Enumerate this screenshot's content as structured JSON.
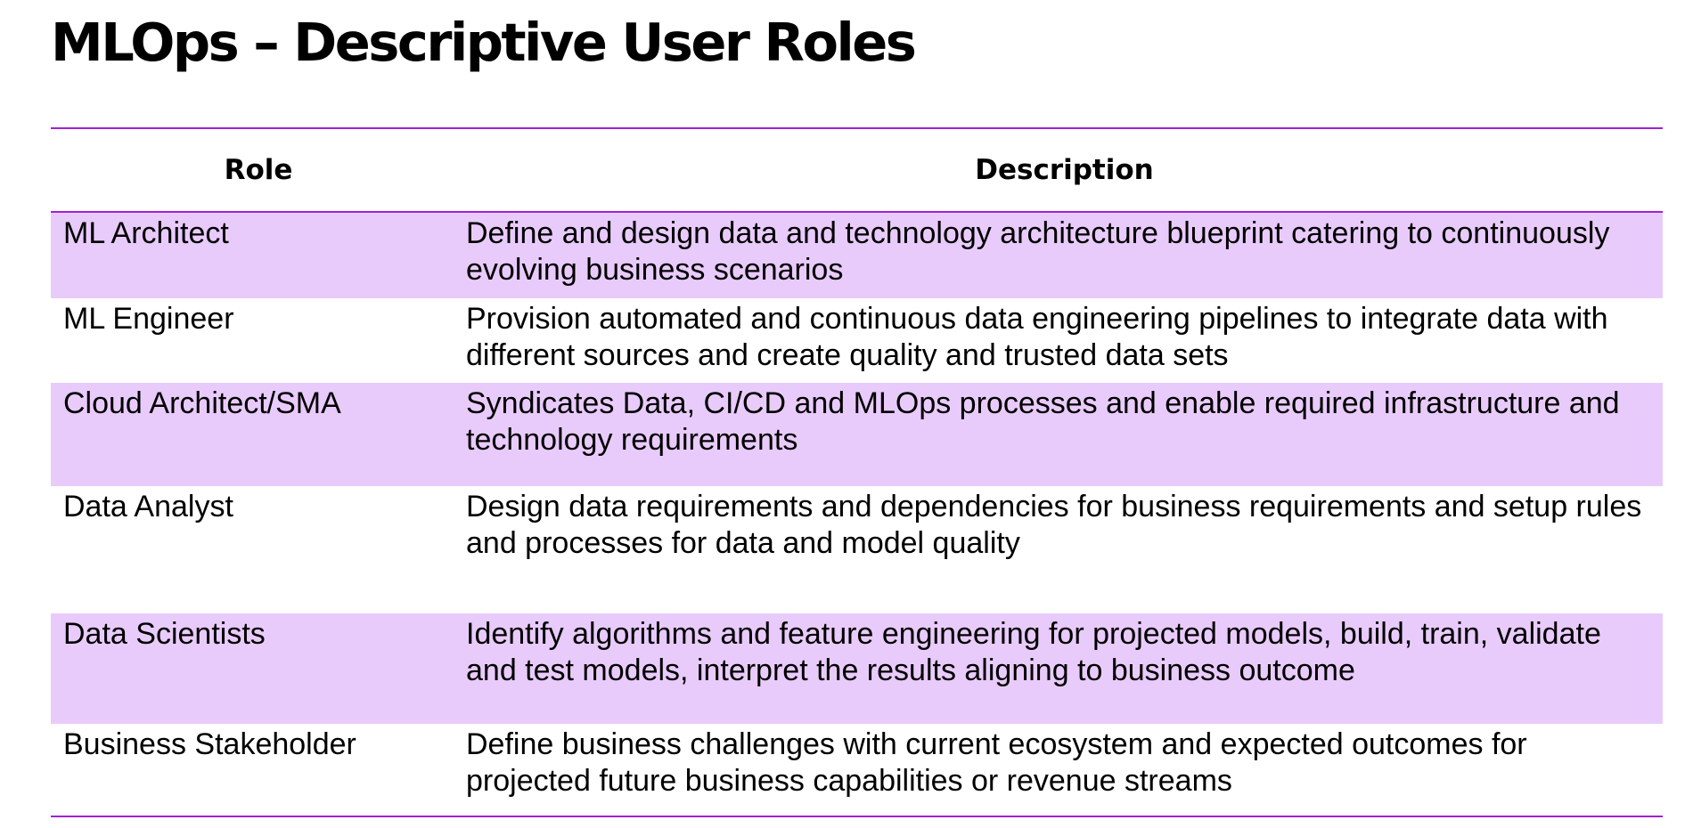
{
  "title": "MLOps – Descriptive User Roles",
  "colors": {
    "accent_line": "#a021d4",
    "row_shade": "#e9cbfb"
  },
  "table": {
    "headers": {
      "role": "Role",
      "description": "Description"
    },
    "rows": [
      {
        "role": "ML Architect",
        "description": "Define and design data and technology architecture blueprint catering to continuously evolving business scenarios"
      },
      {
        "role": "ML Engineer",
        "description": "Provision automated and continuous data engineering pipelines to integrate data with different sources and create quality and trusted data sets"
      },
      {
        "role": "Cloud Architect/SMA",
        "description": "Syndicates Data, CI/CD and MLOps processes and enable required infrastructure and technology requirements"
      },
      {
        "role": "Data Analyst",
        "description": "Design data requirements and dependencies for business requirements and setup rules and processes for data and model quality"
      },
      {
        "role": "Data Scientists",
        "description": "Identify algorithms and feature engineering for projected models, build, train, validate and test models, interpret the results aligning to business outcome"
      },
      {
        "role": "Business Stakeholder",
        "description": "Define business challenges with current ecosystem and expected outcomes for projected future business capabilities or revenue streams"
      }
    ]
  }
}
